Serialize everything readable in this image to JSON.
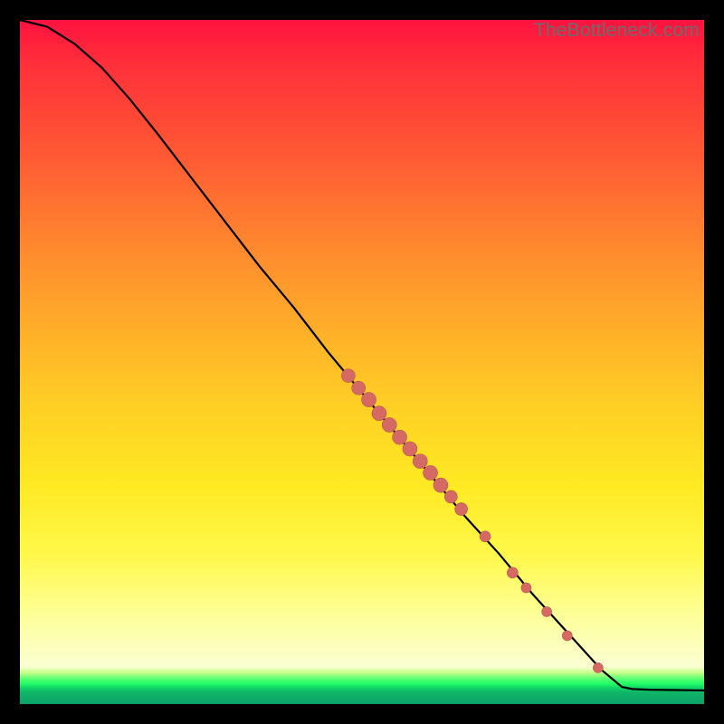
{
  "watermark": "TheBottleneck.com",
  "colors": {
    "curve_stroke": "#000000",
    "marker_fill": "#d46a63",
    "marker_stroke": "#b95751"
  },
  "chart_data": {
    "type": "line",
    "title": "",
    "xlabel": "",
    "ylabel": "",
    "xlim": [
      0,
      100
    ],
    "ylim": [
      0,
      100
    ],
    "curve": [
      {
        "x": 0.0,
        "y": 100.0
      },
      {
        "x": 4.0,
        "y": 99.0
      },
      {
        "x": 8.0,
        "y": 96.5
      },
      {
        "x": 12.0,
        "y": 93.0
      },
      {
        "x": 16.0,
        "y": 88.5
      },
      {
        "x": 20.0,
        "y": 83.5
      },
      {
        "x": 25.0,
        "y": 77.0
      },
      {
        "x": 30.0,
        "y": 70.5
      },
      {
        "x": 35.0,
        "y": 64.0
      },
      {
        "x": 40.0,
        "y": 58.0
      },
      {
        "x": 45.0,
        "y": 51.5
      },
      {
        "x": 50.0,
        "y": 45.5
      },
      {
        "x": 55.0,
        "y": 39.5
      },
      {
        "x": 60.0,
        "y": 33.5
      },
      {
        "x": 65.0,
        "y": 27.5
      },
      {
        "x": 70.0,
        "y": 22.0
      },
      {
        "x": 75.0,
        "y": 16.0
      },
      {
        "x": 80.0,
        "y": 10.5
      },
      {
        "x": 85.0,
        "y": 5.0
      },
      {
        "x": 88.0,
        "y": 2.5
      },
      {
        "x": 89.5,
        "y": 2.2
      },
      {
        "x": 92.0,
        "y": 2.1
      },
      {
        "x": 96.0,
        "y": 2.05
      },
      {
        "x": 100.0,
        "y": 2.0
      }
    ],
    "markers": [
      {
        "x": 48.0,
        "y": 48.0,
        "r": 7.5
      },
      {
        "x": 49.5,
        "y": 46.2,
        "r": 7.5
      },
      {
        "x": 51.0,
        "y": 44.5,
        "r": 8.0
      },
      {
        "x": 52.5,
        "y": 42.5,
        "r": 8.0
      },
      {
        "x": 54.0,
        "y": 40.8,
        "r": 8.0
      },
      {
        "x": 55.5,
        "y": 39.0,
        "r": 8.0
      },
      {
        "x": 57.0,
        "y": 37.3,
        "r": 8.0
      },
      {
        "x": 58.5,
        "y": 35.5,
        "r": 8.0
      },
      {
        "x": 60.0,
        "y": 33.8,
        "r": 8.0
      },
      {
        "x": 61.5,
        "y": 32.0,
        "r": 8.0
      },
      {
        "x": 63.0,
        "y": 30.3,
        "r": 7.0
      },
      {
        "x": 64.5,
        "y": 28.5,
        "r": 7.0
      },
      {
        "x": 68.0,
        "y": 24.5,
        "r": 6.0
      },
      {
        "x": 72.0,
        "y": 19.2,
        "r": 6.0
      },
      {
        "x": 74.0,
        "y": 17.0,
        "r": 5.5
      },
      {
        "x": 77.0,
        "y": 13.5,
        "r": 5.5
      },
      {
        "x": 80.0,
        "y": 10.0,
        "r": 5.5
      },
      {
        "x": 84.5,
        "y": 5.3,
        "r": 5.5
      }
    ]
  }
}
